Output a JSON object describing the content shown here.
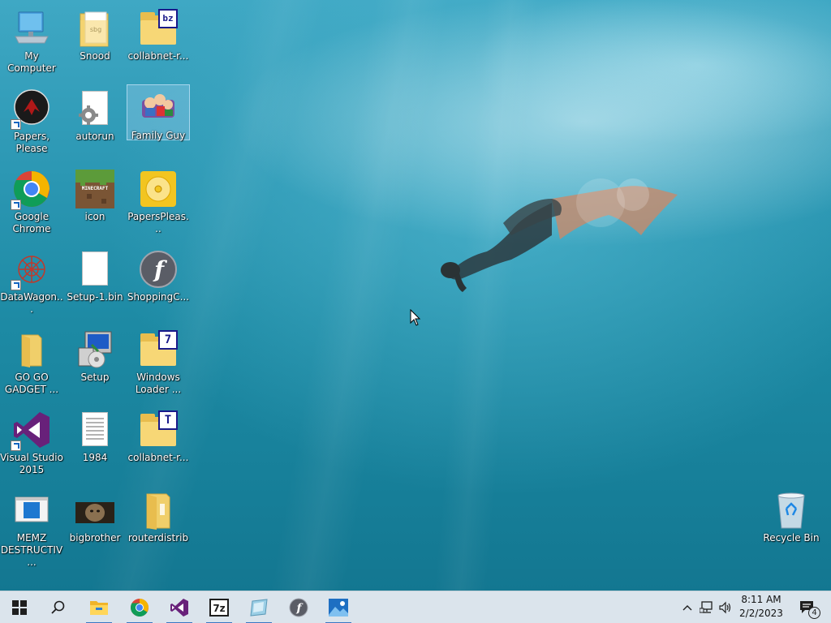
{
  "desktop": {
    "icons": [
      {
        "name": "my-computer",
        "label": "My Computer"
      },
      {
        "name": "snood",
        "label": "Snood"
      },
      {
        "name": "collabnet-r-1",
        "label": "collabnet-r..."
      },
      {
        "name": "papers-please",
        "label": "Papers, Please"
      },
      {
        "name": "autorun",
        "label": "autorun"
      },
      {
        "name": "family-guy",
        "label": "Family Guy"
      },
      {
        "name": "google-chrome",
        "label": "Google Chrome"
      },
      {
        "name": "minecraft-icon",
        "label": "icon"
      },
      {
        "name": "papersplease-disc",
        "label": "PapersPleas..."
      },
      {
        "name": "datawagon",
        "label": "DataWagon..."
      },
      {
        "name": "setup-1-bin",
        "label": "Setup-1.bin"
      },
      {
        "name": "shoppingc",
        "label": "ShoppingC..."
      },
      {
        "name": "go-go-gadget",
        "label": "GO GO GADGET ..."
      },
      {
        "name": "setup",
        "label": "Setup"
      },
      {
        "name": "windows-loader",
        "label": "Windows Loader ..."
      },
      {
        "name": "visual-studio-2015",
        "label": "Visual Studio 2015"
      },
      {
        "name": "1984",
        "label": "1984"
      },
      {
        "name": "collabnet-r-2",
        "label": "collabnet-r..."
      },
      {
        "name": "memz",
        "label": "MEMZ DESTRUCTIV..."
      },
      {
        "name": "bigbrother",
        "label": "bigbrother"
      },
      {
        "name": "routerdistrib",
        "label": "routerdistrib"
      },
      {
        "name": "recycle-bin",
        "label": "Recycle Bin"
      }
    ],
    "badges": {
      "bz": "bz",
      "seven": "7",
      "t": "T",
      "minecraft": "MINECRAFT"
    }
  },
  "taskbar": {
    "clock_time": "8:11 AM",
    "clock_date": "2/2/2023",
    "notification_count": "4",
    "pinned": [
      "start-icon",
      "search-icon",
      "file-explorer-icon",
      "chrome-icon",
      "visual-studio-icon",
      "7zip-icon",
      "app-icon",
      "flash-icon",
      "photos-icon"
    ]
  },
  "colors": {
    "taskbar": "#dbe4ec",
    "active_indicator": "#3b78c4",
    "wallpaper": "#1f8aa0"
  }
}
